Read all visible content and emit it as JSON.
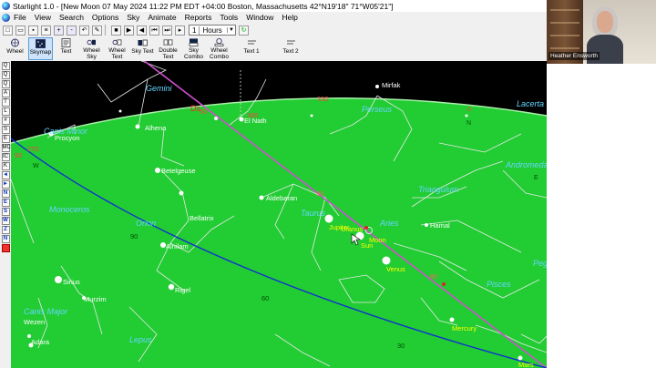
{
  "window": {
    "title": "Starlight 1.0 - [New Moon 07 May 2024 11:22 PM EDT +04:00 Boston, Massachusetts 42°N19'18\" 71°W05'21\"]"
  },
  "menu": {
    "items": [
      "File",
      "View",
      "Search",
      "Options",
      "Sky",
      "Animate",
      "Reports",
      "Tools",
      "Window",
      "Help"
    ]
  },
  "toolbar": {
    "time_step_value": "1",
    "time_step_unit": "Hours",
    "icons": [
      "new-icon",
      "open-icon",
      "save-icon",
      "print-icon",
      "zoom-in-icon",
      "zoom-out-icon",
      "undo-icon",
      "edit-icon",
      "stop-icon",
      "play-icon",
      "step-back-icon",
      "first-icon",
      "last-icon",
      "step-forward-icon",
      "refresh-icon"
    ]
  },
  "view_buttons": [
    {
      "id": "wheel",
      "label": "Wheel",
      "active": false
    },
    {
      "id": "skymap",
      "label": "Skymap",
      "active": true
    },
    {
      "id": "text",
      "label": "Text",
      "active": false
    },
    {
      "id": "wheel-sky",
      "label": "Wheel Sky",
      "active": false
    },
    {
      "id": "wheel-text",
      "label": "Wheel Text",
      "active": false
    },
    {
      "id": "sky-text",
      "label": "Sky Text",
      "active": false
    },
    {
      "id": "double-text",
      "label": "Double Text",
      "active": false
    },
    {
      "id": "sky-combo",
      "label": "Sky Combo",
      "active": false
    },
    {
      "id": "wheel-combo",
      "label": "Wheel Combo",
      "active": false
    },
    {
      "id": "text1",
      "label": "Text 1",
      "active": false
    },
    {
      "id": "text2",
      "label": "Text 2",
      "active": false
    }
  ],
  "sidebar_tools": [
    "Q",
    "Q",
    "Q",
    "A",
    "T",
    "L",
    "#",
    "S",
    "E",
    "MC",
    "IC",
    "K",
    "◄",
    "►",
    "N",
    "E",
    "S",
    "W",
    "Z",
    "N"
  ],
  "skymap": {
    "colors": {
      "sky": "#000000",
      "horizon_fill": "#22cc33",
      "horizon_line": "#aaf0aa",
      "ecliptic": "#d050d0",
      "equator": "#1030d0",
      "constellation": "#e8e8e8",
      "constellation_label": "#66d5ff",
      "planet_label": "#ffff00",
      "star": "#ffffff",
      "node_label": "#ff2020"
    },
    "constellations": [
      "Gemini",
      "Canis Minor",
      "Monoceros",
      "Orion",
      "Taurus",
      "Aries",
      "Perseus",
      "Triangulum",
      "Andromeda",
      "Lacerta",
      "Pisces",
      "Pegasus",
      "Canis Major",
      "Lepus"
    ],
    "stars": [
      "Procyon",
      "Alhena",
      "Betelgeuse",
      "Bellatrix",
      "Alnilam",
      "Rigel",
      "Sirius",
      "Murzim",
      "Wezen",
      "Adara",
      "Aldebaran",
      "El Nath",
      "Mirfak",
      "Hamal"
    ],
    "planets": [
      "Jupiter",
      "Uranus",
      "Moon",
      "Sun",
      "Venus",
      "Mercury",
      "Mars"
    ],
    "node_label": "Ds",
    "ecliptic_degrees": [
      "90",
      "60",
      "30"
    ],
    "horizon_degrees": [
      "330",
      "300",
      "270",
      "0",
      "30",
      "60",
      "90"
    ],
    "equator_degrees": [
      "90",
      "60",
      "30"
    ],
    "cardinal": [
      "W",
      "N",
      "E"
    ]
  },
  "video": {
    "participant_name": "Heather Ensworth"
  }
}
